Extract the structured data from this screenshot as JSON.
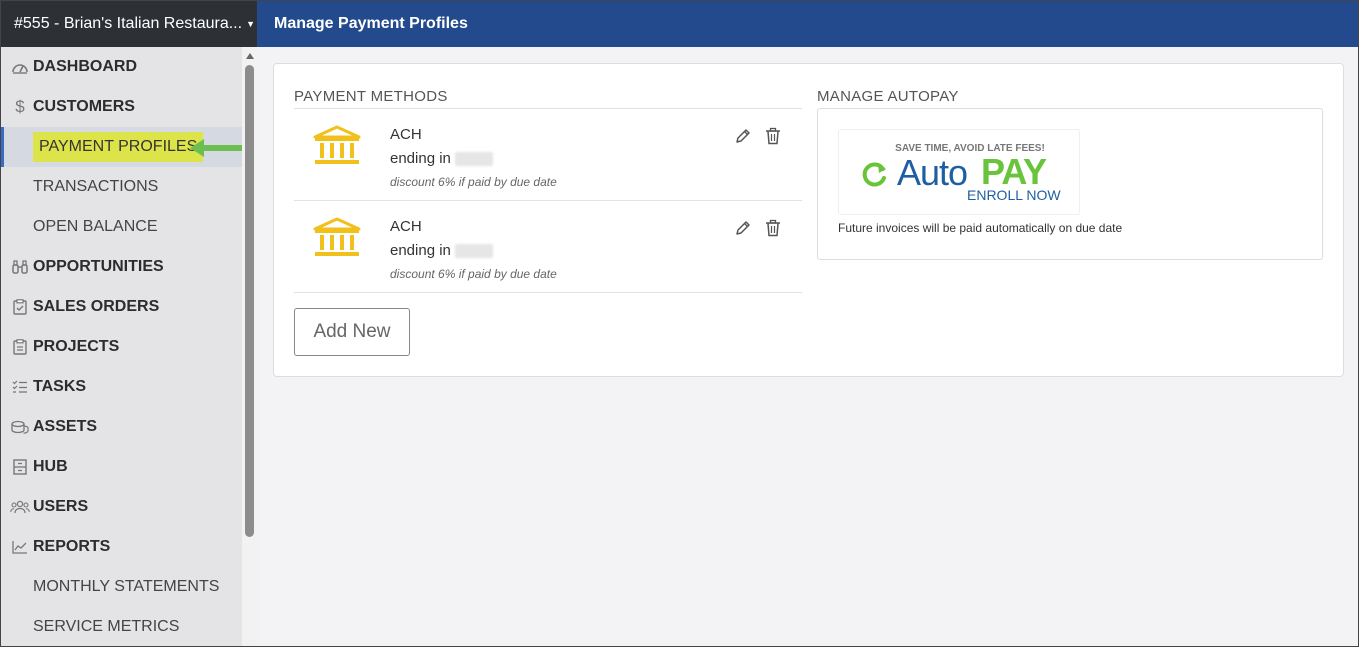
{
  "header": {
    "account": "#555 - Brian's Italian Restaura...",
    "title": "Manage Payment Profiles"
  },
  "sidebar": {
    "items": [
      {
        "label": "DASHBOARD",
        "icon": "dashboard-icon"
      },
      {
        "label": "CUSTOMERS",
        "icon": "dollar-icon"
      },
      {
        "label": "PAYMENT PROFILES"
      },
      {
        "label": "TRANSACTIONS"
      },
      {
        "label": "OPEN BALANCE"
      },
      {
        "label": "OPPORTUNITIES",
        "icon": "binoculars-icon"
      },
      {
        "label": "SALES ORDERS",
        "icon": "clipboard-check-icon"
      },
      {
        "label": "PROJECTS",
        "icon": "clipboard-icon"
      },
      {
        "label": "TASKS",
        "icon": "list-icon"
      },
      {
        "label": "ASSETS",
        "icon": "coins-icon"
      },
      {
        "label": "HUB",
        "icon": "cabinet-icon"
      },
      {
        "label": "USERS",
        "icon": "users-icon"
      },
      {
        "label": "REPORTS",
        "icon": "chart-icon"
      },
      {
        "label": "MONTHLY STATEMENTS"
      },
      {
        "label": "SERVICE METRICS"
      }
    ]
  },
  "payment_methods": {
    "title": "PAYMENT METHODS",
    "items": [
      {
        "type": "ACH",
        "ending_label": "ending in",
        "discount": "discount 6% if paid by due date"
      },
      {
        "type": "ACH",
        "ending_label": "ending in",
        "discount": "discount 6% if paid by due date"
      }
    ],
    "add_label": "Add New"
  },
  "autopay": {
    "title": "MANAGE AUTOPAY",
    "tagline": "SAVE TIME, AVOID LATE FEES!",
    "auto": "Auto",
    "pay": "PAY",
    "enroll": "ENROLL NOW",
    "note": "Future invoices will be paid automatically on due date"
  },
  "colors": {
    "header": "#224a8c",
    "sidebar": "#e4e4e6",
    "highlight": "#dde44a",
    "arrow": "#6cbf4f",
    "bank_icon": "#f2c01a"
  }
}
